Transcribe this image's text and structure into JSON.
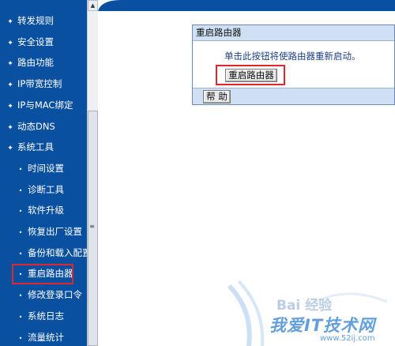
{
  "sidebar": {
    "items": [
      {
        "label": "转发规则",
        "level": "top"
      },
      {
        "label": "安全设置",
        "level": "top"
      },
      {
        "label": "路由功能",
        "level": "top"
      },
      {
        "label": "IP带宽控制",
        "level": "top"
      },
      {
        "label": "IP与MAC绑定",
        "level": "top"
      },
      {
        "label": "动态DNS",
        "level": "top"
      },
      {
        "label": "系统工具",
        "level": "top"
      },
      {
        "label": "时间设置",
        "level": "sub"
      },
      {
        "label": "诊断工具",
        "level": "sub"
      },
      {
        "label": "软件升级",
        "level": "sub"
      },
      {
        "label": "恢复出厂设置",
        "level": "sub"
      },
      {
        "label": "备份和载入配置",
        "level": "sub"
      },
      {
        "label": "重启路由器",
        "level": "sub"
      },
      {
        "label": "修改登录口令",
        "level": "sub"
      },
      {
        "label": "系统日志",
        "level": "sub"
      },
      {
        "label": "流量统计",
        "level": "sub"
      }
    ],
    "selected_index": 12
  },
  "panel": {
    "title": "重启路由器",
    "message": "单击此按钮将使路由器重新启动。",
    "reboot_button": "重启路由器",
    "help_button": "帮 助"
  },
  "watermark": {
    "baidu": "Bai 经验",
    "site_name": "我爱IT技术网",
    "site_url": "www.52ij.com"
  },
  "colors": {
    "sidebar_bg": "#0a50a1",
    "panel_header_bg": "#cfe0f4",
    "highlight_box": "#e0262f"
  }
}
